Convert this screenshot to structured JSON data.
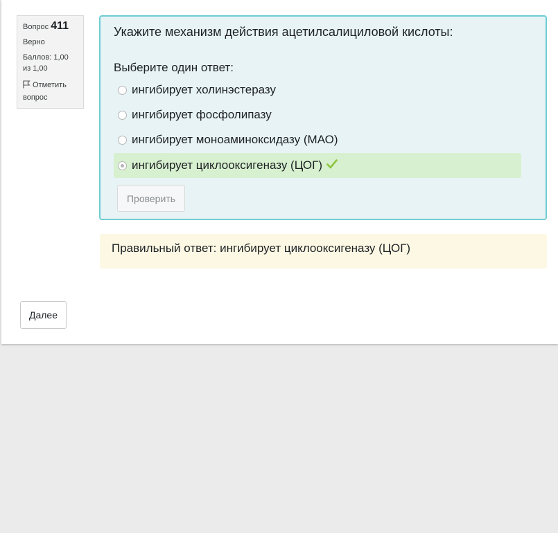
{
  "info": {
    "question_label": "Вопрос",
    "question_number": "411",
    "status": "Верно",
    "score": "Баллов: 1,00 из 1,00",
    "flag_label": "Отметить вопрос"
  },
  "question": {
    "text": "Укажите механизм действия ацетилсалициловой кислоты:",
    "prompt": "Выберите один ответ:",
    "options": [
      {
        "label": "ингибирует холинэстеразу",
        "selected": false,
        "correct": false
      },
      {
        "label": "ингибирует фосфолипазу",
        "selected": false,
        "correct": false
      },
      {
        "label": "ингибирует моноаминоксидазу (МАО)",
        "selected": false,
        "correct": false
      },
      {
        "label": "ингибирует циклооксигеназу (ЦОГ)",
        "selected": true,
        "correct": true
      }
    ],
    "check_button": "Проверить"
  },
  "feedback": {
    "correct_answer": "Правильный ответ: ингибирует циклооксигеназу (ЦОГ)"
  },
  "navigation": {
    "next_button": "Далее"
  },
  "colors": {
    "question_bg": "#e8f3f6",
    "question_border": "#6ecdd3",
    "correct_bg": "#d7f0cf",
    "feedback_bg": "#fcf8e3",
    "check_mark": "#8cc63f"
  }
}
